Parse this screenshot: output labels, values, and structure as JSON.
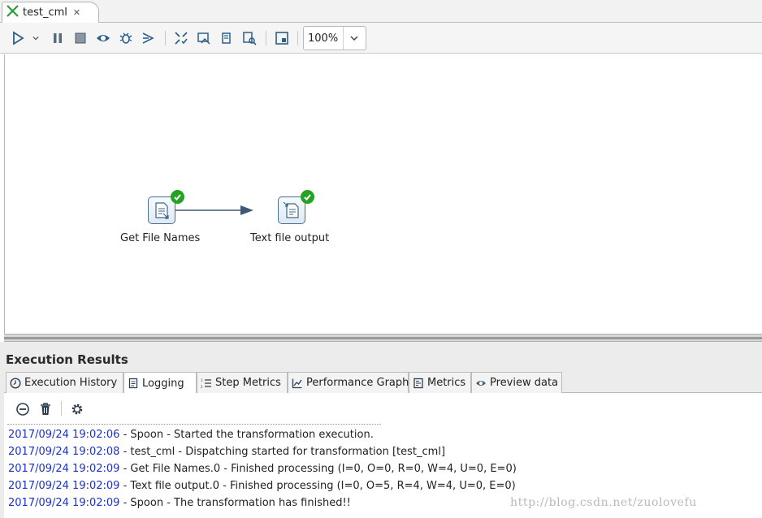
{
  "tab": {
    "title": "test_cml"
  },
  "toolbar": {
    "buttons": [
      "run-icon",
      "run-options-icon",
      "pause-icon",
      "stop-icon",
      "preview-icon",
      "debug-icon",
      "replay-icon",
      "verify-icon",
      "impact-icon",
      "sql-icon",
      "explore-db-icon",
      "show-results-icon"
    ],
    "zoom": "100%"
  },
  "canvas": {
    "steps": [
      {
        "label": "Get File Names",
        "status": "finished"
      },
      {
        "label": "Text file output",
        "status": "finished"
      }
    ]
  },
  "results": {
    "title": "Execution Results",
    "tabs": [
      "Execution History",
      "Logging",
      "Step Metrics",
      "Performance Graph",
      "Metrics",
      "Preview data"
    ],
    "active_tab": "Logging",
    "log": [
      {
        "ts": "2017/09/24 19:02:06",
        "msg": " - Spoon - Started the transformation execution."
      },
      {
        "ts": "2017/09/24 19:02:08",
        "msg": " - test_cml - Dispatching started for transformation [test_cml]"
      },
      {
        "ts": "2017/09/24 19:02:09",
        "msg": " - Get File Names.0 - Finished processing (I=0, O=0, R=0, W=4, U=0, E=0)"
      },
      {
        "ts": "2017/09/24 19:02:09",
        "msg": " - Text file output.0 - Finished processing (I=0, O=5, R=4, W=4, U=0, E=0)"
      },
      {
        "ts": "2017/09/24 19:02:09",
        "msg": " - Spoon - The transformation has finished!!"
      }
    ]
  },
  "watermark": "http://blog.csdn.net/zuolovefu",
  "colors": {
    "timestamp": "#1a31c9",
    "ok": "#23a223",
    "hop": "#3d5a72"
  }
}
